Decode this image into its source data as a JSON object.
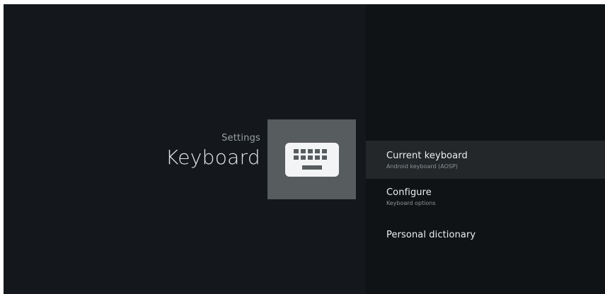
{
  "header": {
    "breadcrumb": "Settings",
    "title": "Keyboard"
  },
  "icon": {
    "name": "keyboard-icon"
  },
  "menu": {
    "items": [
      {
        "title": "Current keyboard",
        "summary": "Android keyboard (AOSP)",
        "selected": true
      },
      {
        "title": "Configure",
        "summary": "Keyboard options",
        "selected": false
      },
      {
        "title": "Personal dictionary",
        "summary": "",
        "selected": false
      }
    ]
  },
  "colors": {
    "background_left": "#14181c",
    "background_right": "#101315",
    "selected_row": "#23272a",
    "icon_tile": "#575c5f"
  }
}
